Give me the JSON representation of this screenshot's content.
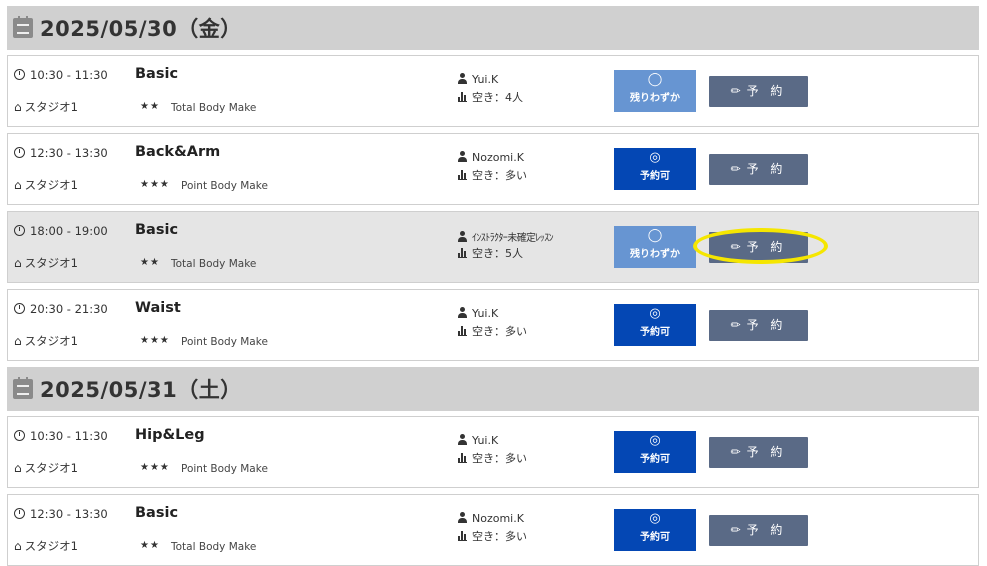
{
  "days": [
    {
      "date": "2025/05/30（金）",
      "lessons": [
        {
          "time": "10:30 - 11:30",
          "studio": "スタジオ1",
          "name": "Basic",
          "stars": "★★",
          "type": "Total Body Make",
          "instructor": "Yui.K",
          "availability": "空き：4人",
          "status_symbol": "◯",
          "status_label": "残りわずか",
          "reserve_label": "予 約"
        },
        {
          "time": "12:30 - 13:30",
          "studio": "スタジオ1",
          "name": "Back&Arm",
          "stars": "★★★",
          "type": "Point Body Make",
          "instructor": "Nozomi.K",
          "availability": "空き：多い",
          "status_symbol": "◎",
          "status_label": "予約可",
          "reserve_label": "予 約"
        },
        {
          "time": "18:00 - 19:00",
          "studio": "スタジオ1",
          "name": "Basic",
          "stars": "★★",
          "type": "Total Body Make",
          "instructor": "ｲﾝｽﾄﾗｸﾀｰ未確定ﾚｯｽﾝ",
          "availability": "空き：5人",
          "status_symbol": "◯",
          "status_label": "残りわずか",
          "reserve_label": "予 約"
        },
        {
          "time": "20:30 - 21:30",
          "studio": "スタジオ1",
          "name": "Waist",
          "stars": "★★★",
          "type": "Point Body Make",
          "instructor": "Yui.K",
          "availability": "空き：多い",
          "status_symbol": "◎",
          "status_label": "予約可",
          "reserve_label": "予 約"
        }
      ]
    },
    {
      "date": "2025/05/31（土）",
      "lessons": [
        {
          "time": "10:30 - 11:30",
          "studio": "スタジオ1",
          "name": "Hip&Leg",
          "stars": "★★★",
          "type": "Point Body Make",
          "instructor": "Yui.K",
          "availability": "空き：多い",
          "status_symbol": "◎",
          "status_label": "予約可",
          "reserve_label": "予 約"
        },
        {
          "time": "12:30 - 13:30",
          "studio": "スタジオ1",
          "name": "Basic",
          "stars": "★★",
          "type": "Total Body Make",
          "instructor": "Nozomi.K",
          "availability": "空き：多い",
          "status_symbol": "◎",
          "status_label": "予約可",
          "reserve_label": "予 約"
        }
      ]
    }
  ],
  "colors": {
    "status_few": "#6795d2",
    "status_available": "#0447b4",
    "reserve_button": "#5a6a86",
    "header_bg": "#d0d0d0",
    "highlight": "#f5e600"
  }
}
